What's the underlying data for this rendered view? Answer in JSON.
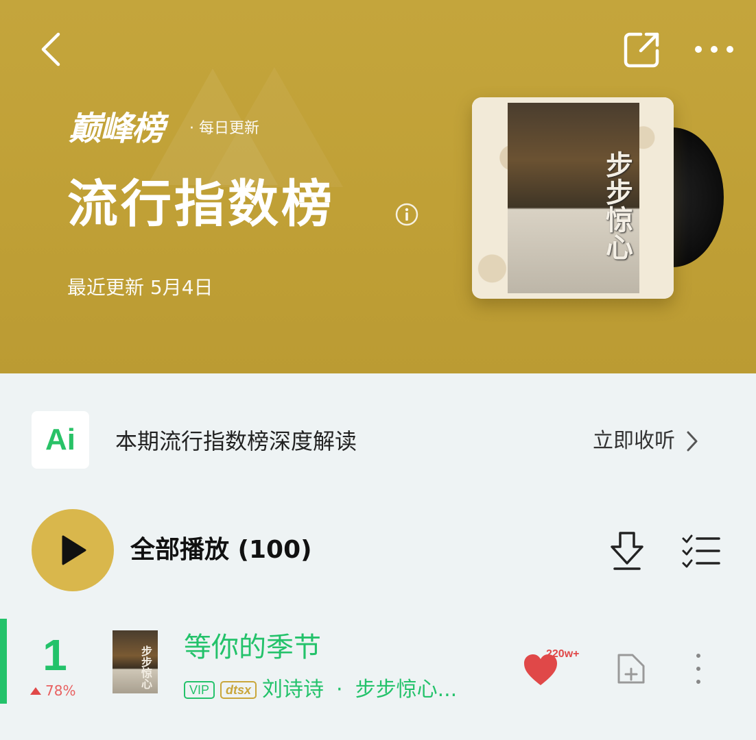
{
  "header": {
    "brand": "巅峰榜",
    "brand_sub": "· 每日更新",
    "title": "流行指数榜",
    "update_text": "最近更新 5月4日",
    "cover_calligraphy": "步步惊心"
  },
  "ai_banner": {
    "logo_text": "Ai",
    "text": "本期流行指数榜深度解读",
    "action": "立即收听"
  },
  "play_all": {
    "label": "全部播放 (100)"
  },
  "songs": [
    {
      "rank": "1",
      "rank_change": "78%",
      "thumb_text": "步步惊心",
      "title": "等你的季节",
      "badge_vip": "VIP",
      "badge_dts": "dtsx",
      "artist": "刘诗诗",
      "separator": "·",
      "album": "步步惊心...",
      "like_count": "220w+"
    }
  ],
  "colors": {
    "header_bg": "#c0a036",
    "accent_green": "#23c26a",
    "play_button": "#d9b74c",
    "like_red": "#e04848"
  },
  "icons": {
    "back": "chevron-left-icon",
    "share": "share-icon",
    "more": "more-horizontal-icon",
    "info": "info-icon",
    "chevron": "chevron-right-icon",
    "play": "play-icon",
    "download": "download-icon",
    "multi_select": "checklist-icon",
    "like": "heart-icon",
    "add_to": "add-to-playlist-icon",
    "song_more": "more-vertical-icon"
  }
}
